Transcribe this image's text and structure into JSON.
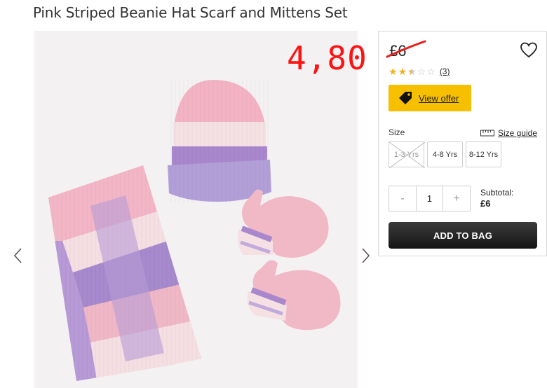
{
  "product": {
    "title": "Pink Striped Beanie Hat Scarf and Mittens Set",
    "image_alt": "pink-striped-knit-set-photo"
  },
  "annotation": {
    "price_text": "4,80",
    "color": "#ff1212"
  },
  "panel": {
    "original_price": "£6",
    "wishlist_icon": "heart-icon",
    "rating": {
      "value": 2.5,
      "max": 5,
      "count_text": "(3)"
    },
    "offer": {
      "icon": "tag-icon",
      "label": "View offer"
    },
    "size": {
      "label": "Size",
      "guide_label": "Size guide",
      "guide_icon": "ruler-icon",
      "options": [
        {
          "label": "1-3 Yrs",
          "available": false
        },
        {
          "label": "4-8 Yrs",
          "available": true
        },
        {
          "label": "8-12 Yrs",
          "available": true
        }
      ]
    },
    "quantity": {
      "minus": "-",
      "value": "1",
      "plus": "+"
    },
    "subtotal": {
      "label": "Subtotal:",
      "amount": "£6"
    },
    "add_to_bag_label": "ADD TO BAG"
  },
  "gallery": {
    "prev_icon": "chevron-left-icon",
    "next_icon": "chevron-right-icon"
  },
  "colors": {
    "accent_yellow": "#f6c000",
    "star": "#f2b01e",
    "button_dark": "#1f1f1f",
    "strike_red": "#e5201d"
  }
}
